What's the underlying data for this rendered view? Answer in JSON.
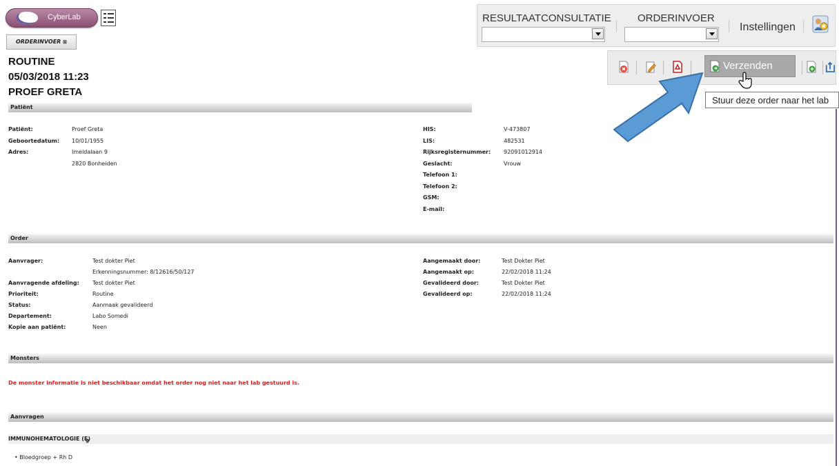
{
  "app": {
    "logo_text": "CyberLab"
  },
  "tabs": {
    "orderinvoer": "ORDERINVOER",
    "orderinvoer_badge": "⊠"
  },
  "header": {
    "line1": "ROUTINE",
    "line2": "05/03/2018 11:23",
    "line3": "PROEF GRETA"
  },
  "nav": {
    "resultaat": "RESULTAATCONSULTATIE",
    "orderinvoer": "ORDERINVOER",
    "instellingen": "Instellingen",
    "resultaat_select_value": "",
    "orderinvoer_select_value": ""
  },
  "toolbar": {
    "verzenden": "Verzenden",
    "tooltip": "Stuur deze order naar het lab",
    "icons": [
      "cancel-order-icon",
      "edit-icon",
      "pdf-icon",
      "send-icon",
      "add-icon",
      "export-icon"
    ]
  },
  "sections": {
    "patient": "Patiënt",
    "order": "Order",
    "monsters": "Monsters",
    "aanvragen": "Aanvragen"
  },
  "patient": {
    "left": [
      {
        "label": "Patiënt:",
        "value": "Proef Greta"
      },
      {
        "label": "Geboortedatum:",
        "value": "10/01/1955"
      },
      {
        "label": "Adres:",
        "value": "Imeldalaan 9"
      },
      {
        "label": "",
        "value": "2820 Bonheiden"
      }
    ],
    "right": [
      {
        "label": "HIS:",
        "value": "V-473807"
      },
      {
        "label": "LIS:",
        "value": "482531"
      },
      {
        "label": "Rijksregisternummer:",
        "value": "92091012914"
      },
      {
        "label": "Geslacht:",
        "value": "Vrouw"
      },
      {
        "label": "Telefoon 1:",
        "value": ""
      },
      {
        "label": "Telefoon 2:",
        "value": ""
      },
      {
        "label": "GSM:",
        "value": ""
      },
      {
        "label": "E-mail:",
        "value": ""
      }
    ]
  },
  "order": {
    "left": [
      {
        "label": "Aanvrager:",
        "value": "Test dokter Piet"
      },
      {
        "label": "",
        "value": "Erkenningsnummer: 8/12616/50/127"
      },
      {
        "label": "Aanvragende afdeling:",
        "value": "Test dokter Piet"
      },
      {
        "label": "Prioriteit:",
        "value": "Routine"
      },
      {
        "label": "Status:",
        "value": "Aanmaak gevalideerd"
      },
      {
        "label": "Departement:",
        "value": "Labo Somedi"
      },
      {
        "label": "Kopie aan patiënt:",
        "value": "Neen"
      }
    ],
    "right": [
      {
        "label": "Aangemaakt door:",
        "value": "Test Dokter Piet"
      },
      {
        "label": "Aangemaakt op:",
        "value": "22/02/2018 11:24"
      },
      {
        "label": "Gevalideerd door:",
        "value": "Test Dokter Piet"
      },
      {
        "label": "Gevalideerd op:",
        "value": "22/02/2018 11:24"
      }
    ]
  },
  "monsters": {
    "message": "De monster informatie is niet beschikbaar omdat het order nog niet naar het lab gestuurd is."
  },
  "aanvragen": {
    "group": "IMMUNOHEMATOLOGIE (E)",
    "group_suffix": "g",
    "items": [
      "Bloedgroep + Rh D"
    ]
  },
  "colors": {
    "error": "#e02020",
    "accent_arrow": "#5b9bd5",
    "logo": "#8a4f73"
  }
}
